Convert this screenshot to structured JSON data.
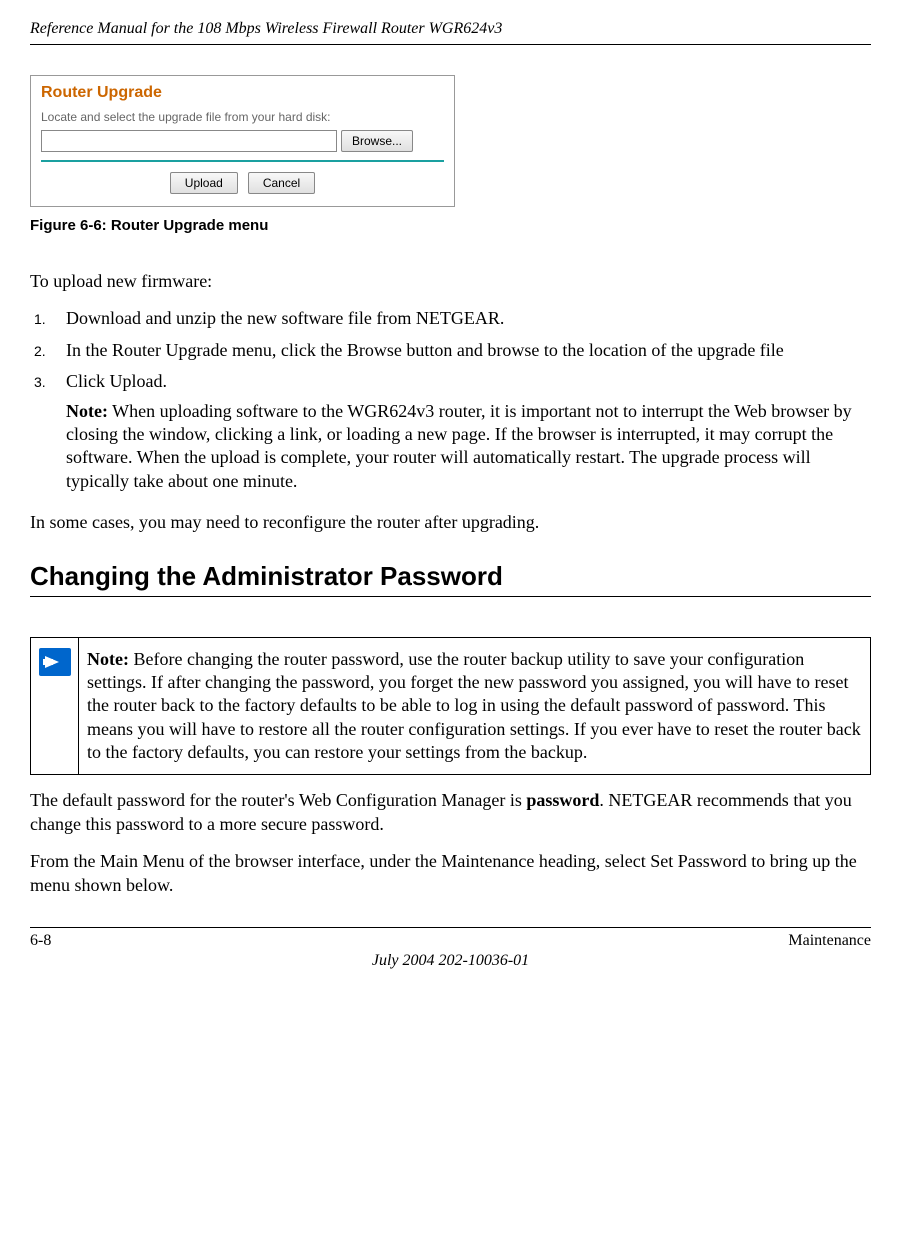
{
  "header": {
    "title": "Reference Manual for the 108 Mbps Wireless Firewall Router WGR624v3"
  },
  "screenshot": {
    "title": "Router Upgrade",
    "instruction": "Locate and select the upgrade file from your hard disk:",
    "browse_btn": "Browse...",
    "upload_btn": "Upload",
    "cancel_btn": "Cancel"
  },
  "figure_caption": "Figure 6-6:  Router Upgrade menu",
  "intro_text": "To upload new firmware:",
  "steps": [
    "Download and unzip the new software file from NETGEAR.",
    "In the Router Upgrade menu, click the Browse button and browse to the location of the upgrade file",
    "Click Upload."
  ],
  "note_label": "Note:",
  "note_after_step3": " When uploading software to the WGR624v3 router, it is important not to interrupt the Web browser by closing the window, clicking a link, or loading a new page. If the browser is interrupted, it may corrupt the software. When the upload is complete, your router will automatically restart. The upgrade process will typically take about one minute.",
  "reconfigure_text": "In some cases, you may need to reconfigure the router after upgrading.",
  "section_heading": "Changing the Administrator Password",
  "note_box": {
    "prefix": "Note:",
    "text": " Before changing the router password, use the router backup utility to save your configuration settings. If after changing the password, you forget the new password you assigned, you will have to reset the router back to the factory defaults to be able to log in using the default password of password. This means you will have to restore all the router configuration settings. If you ever have to reset the router back to the factory defaults, you can restore your settings from the backup."
  },
  "default_pw_pre": "The default password for the router's Web Configuration Manager is ",
  "default_pw_bold": "password",
  "default_pw_post": ". NETGEAR recommends that you change this password to a more secure password.",
  "menu_text": "From the Main Menu of the browser interface, under the Maintenance heading, select Set Password to bring up the menu shown below.",
  "footer": {
    "page": "6-8",
    "section": "Maintenance",
    "date": "July 2004 202-10036-01"
  }
}
